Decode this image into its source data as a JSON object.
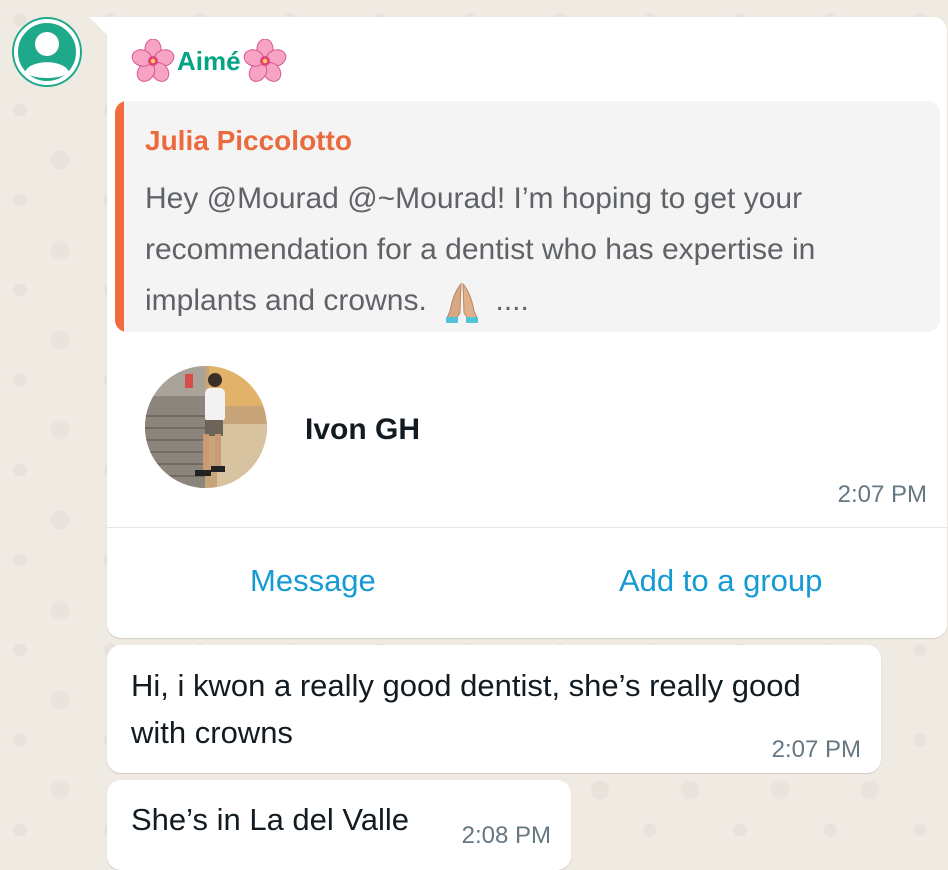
{
  "sender": {
    "name": "Aimé",
    "decoration": "cherry-blossom-emoji"
  },
  "quoted": {
    "author": "Julia Piccolotto",
    "text": "Hey @Mourad @~Mourad! I’m hoping to get your recommendation for a dentist who has expertise in implants and crowns.",
    "emoji": "folded-hands-emoji",
    "ellipsis": "...."
  },
  "contact_card": {
    "name": "Ivon GH",
    "time": "2:07 PM",
    "actions": {
      "message": "Message",
      "add_to_group": "Add to a group"
    }
  },
  "messages": [
    {
      "text": "Hi, i kwon a really good dentist, she’s really good with crowns",
      "time": "2:07 PM"
    },
    {
      "text": "She’s in La del Valle",
      "time": "2:08 PM"
    }
  ],
  "colors": {
    "sender_name": "#06a386",
    "quote_author": "#ea6a3e",
    "quote_bar": "#f46a3f",
    "link": "#159ad4",
    "avatar_bg": "#1fa98b",
    "chat_bg": "#efeae2"
  }
}
